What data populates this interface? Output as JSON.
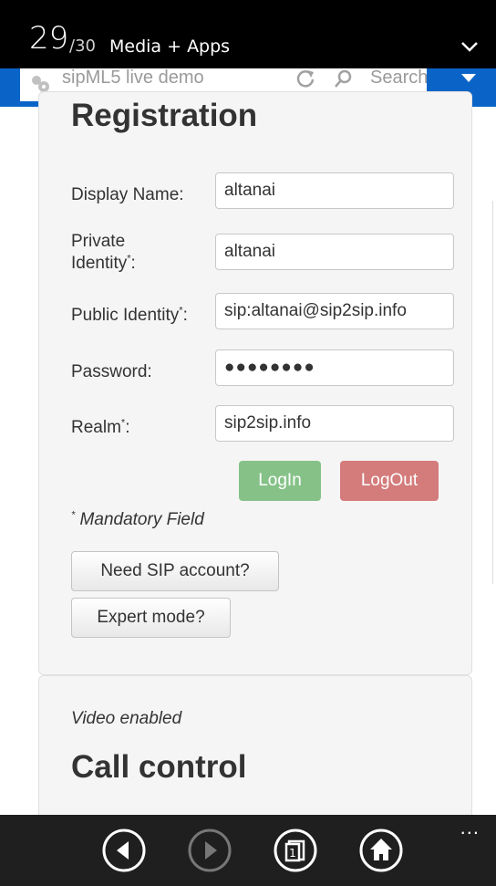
{
  "status": {
    "counter_current": "29",
    "counter_total": "/30",
    "section_title": "Media + Apps"
  },
  "browser": {
    "url_text": "sipML5 live demo",
    "search_placeholder": "Search"
  },
  "registration": {
    "title": "Registration",
    "fields": {
      "display_name": {
        "label": "Display Name:",
        "value": "altanai"
      },
      "private_identity": {
        "label_line1": "Private",
        "label_line2": "Identity",
        "marker": "*",
        "suffix": ":",
        "value": "altanai"
      },
      "public_identity": {
        "label": "Public Identity",
        "marker": "*",
        "suffix": ":",
        "value": "sip:altanai@sip2sip.info"
      },
      "password": {
        "label": "Password:",
        "value": "●●●●●●●●"
      },
      "realm": {
        "label": "Realm",
        "marker": "*",
        "suffix": ":",
        "value": "sip2sip.info"
      }
    },
    "login_label": "LogIn",
    "logout_label": "LogOut",
    "mandatory_marker": "*",
    "mandatory_note": " Mandatory Field",
    "need_sip_label": "Need SIP account?",
    "expert_mode_label": "Expert mode?"
  },
  "call": {
    "video_status": "Video enabled",
    "title": "Call control"
  },
  "appbar": {
    "more_label": "..."
  },
  "colors": {
    "status_bar": "#000000",
    "address_band": "#0a64c8",
    "login_button": "#86c288",
    "logout_button": "#d47b7b",
    "app_bar": "#1f1f1f"
  }
}
